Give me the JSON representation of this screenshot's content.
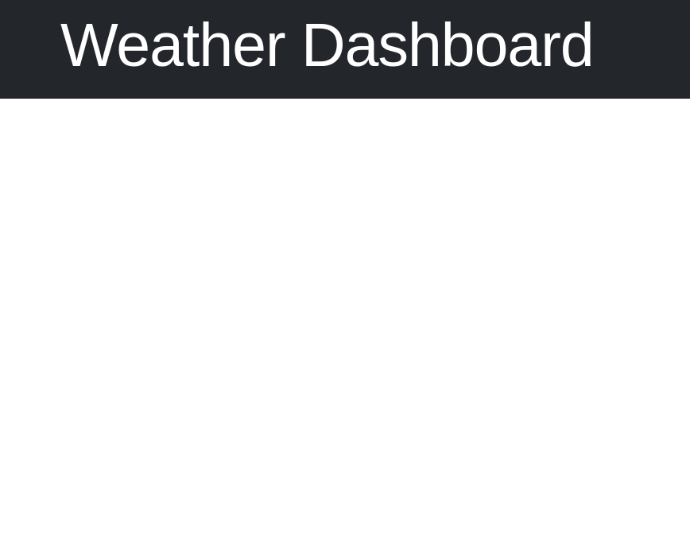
{
  "header": {
    "title": "Weather Dashboard",
    "background_color": "#23262b",
    "text_color": "#ffffff"
  },
  "main": {
    "background_color": "#ffffff"
  }
}
